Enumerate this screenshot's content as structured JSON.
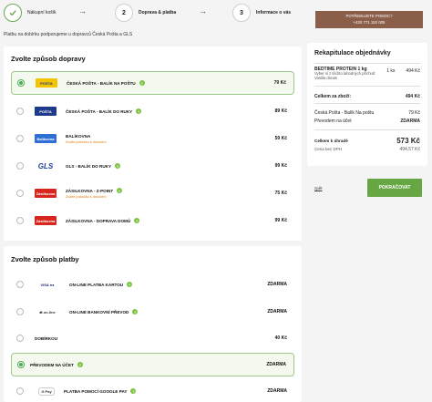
{
  "steps": [
    {
      "label": "Nákupní košík",
      "number": "",
      "state": "done"
    },
    {
      "label": "Doprava & platba",
      "number": "2",
      "state": "active"
    },
    {
      "label": "Informace o vás",
      "number": "3",
      "state": "todo"
    }
  ],
  "notice": "Platbu na dobírku podporujeme u dopravců Česká Pošta a GLS",
  "delivery": {
    "title": "Zvolte způsob dopravy",
    "options": [
      {
        "name": "ČESKÁ POŠTA - BALÍK NA POŠTU",
        "sub": "",
        "price": "79 Kč",
        "logo": "ceska-posta-logo",
        "logo_color": "#f5c400",
        "selected": true
      },
      {
        "name": "ČESKÁ POŠTA - BALÍK DO RUKY",
        "sub": "",
        "price": "89 Kč",
        "logo": "ceska-posta-logo",
        "logo_color": "#1e3a8a",
        "selected": false
      },
      {
        "name": "BALÍKOVNA",
        "sub": "Zvolte pobočku k doručení",
        "price": "59 Kč",
        "logo": "balikovna-logo",
        "logo_color": "#2f6fd6",
        "selected": false
      },
      {
        "name": "GLS - BALÍK DO RUKY",
        "sub": "",
        "price": "99 Kč",
        "logo": "gls-logo",
        "logo_color": "#1c3f94",
        "selected": false
      },
      {
        "name": "ZÁSILKOVNA - Z-POINT",
        "sub": "Zvolte pobočku k doručení",
        "price": "75 Kč",
        "logo": "zasilkovna-logo",
        "logo_color": "#d7261e",
        "selected": false
      },
      {
        "name": "ZÁSILKOVNA - DOPRAVA DOMŮ",
        "sub": "",
        "price": "99 Kč",
        "logo": "zasilkovna-logo",
        "logo_color": "#d7261e",
        "selected": false
      }
    ]
  },
  "payment": {
    "title": "Zvolte způsob platby",
    "options": [
      {
        "name": "ON-LINE PLATBA KARTOU",
        "price": "ZDARMA",
        "logo": "card-logos",
        "selected": false
      },
      {
        "name": "ON-LINE BANKOVNÍ PŘEVOD",
        "price": "ZDARMA",
        "logo": "bank-transfer-logo",
        "selected": false
      },
      {
        "name": "DOBÍRKOU",
        "price": "40 Kč",
        "logo": "",
        "selected": false
      },
      {
        "name": "PŘEVODEM NA ÚČET",
        "price": "ZDARMA",
        "logo": "",
        "selected": true
      },
      {
        "name": "PLATBA POMOCÍ GOOGLE PAY",
        "price": "ZDARMA",
        "logo": "google-pay-logo",
        "selected": false
      }
    ]
  },
  "support": {
    "label": "POTŘEBUJETE POMOC?",
    "phone": "+420 771 152 005"
  },
  "summary": {
    "title": "Rekapitulace objednávky",
    "product_name": "BEDTIME PROTEIN 1 kg",
    "product_desc": "Vyber si z těchto lahodných příchutí: Vanilla dream",
    "qty": "1 ks",
    "product_price": "494 Kč",
    "items_label": "Celkem za zboží:",
    "items_total": "494 Kč",
    "shipping_label": "Česká Pošta - Balík Na poštu",
    "shipping_price": "79 Kč",
    "payment_label": "Převodem na účet",
    "payment_price": "ZDARMA",
    "total_label": "Celkem k úhradě",
    "total": "573 Kč",
    "vat_label": "Cena bez DPH",
    "vat_price": "494,57 Kč"
  },
  "back_label": "zpět",
  "continue_label": "POKRAČOVAT",
  "colors": {
    "accent": "#66a744",
    "support": "#8b5e4a",
    "warning_text": "#e07b00"
  }
}
